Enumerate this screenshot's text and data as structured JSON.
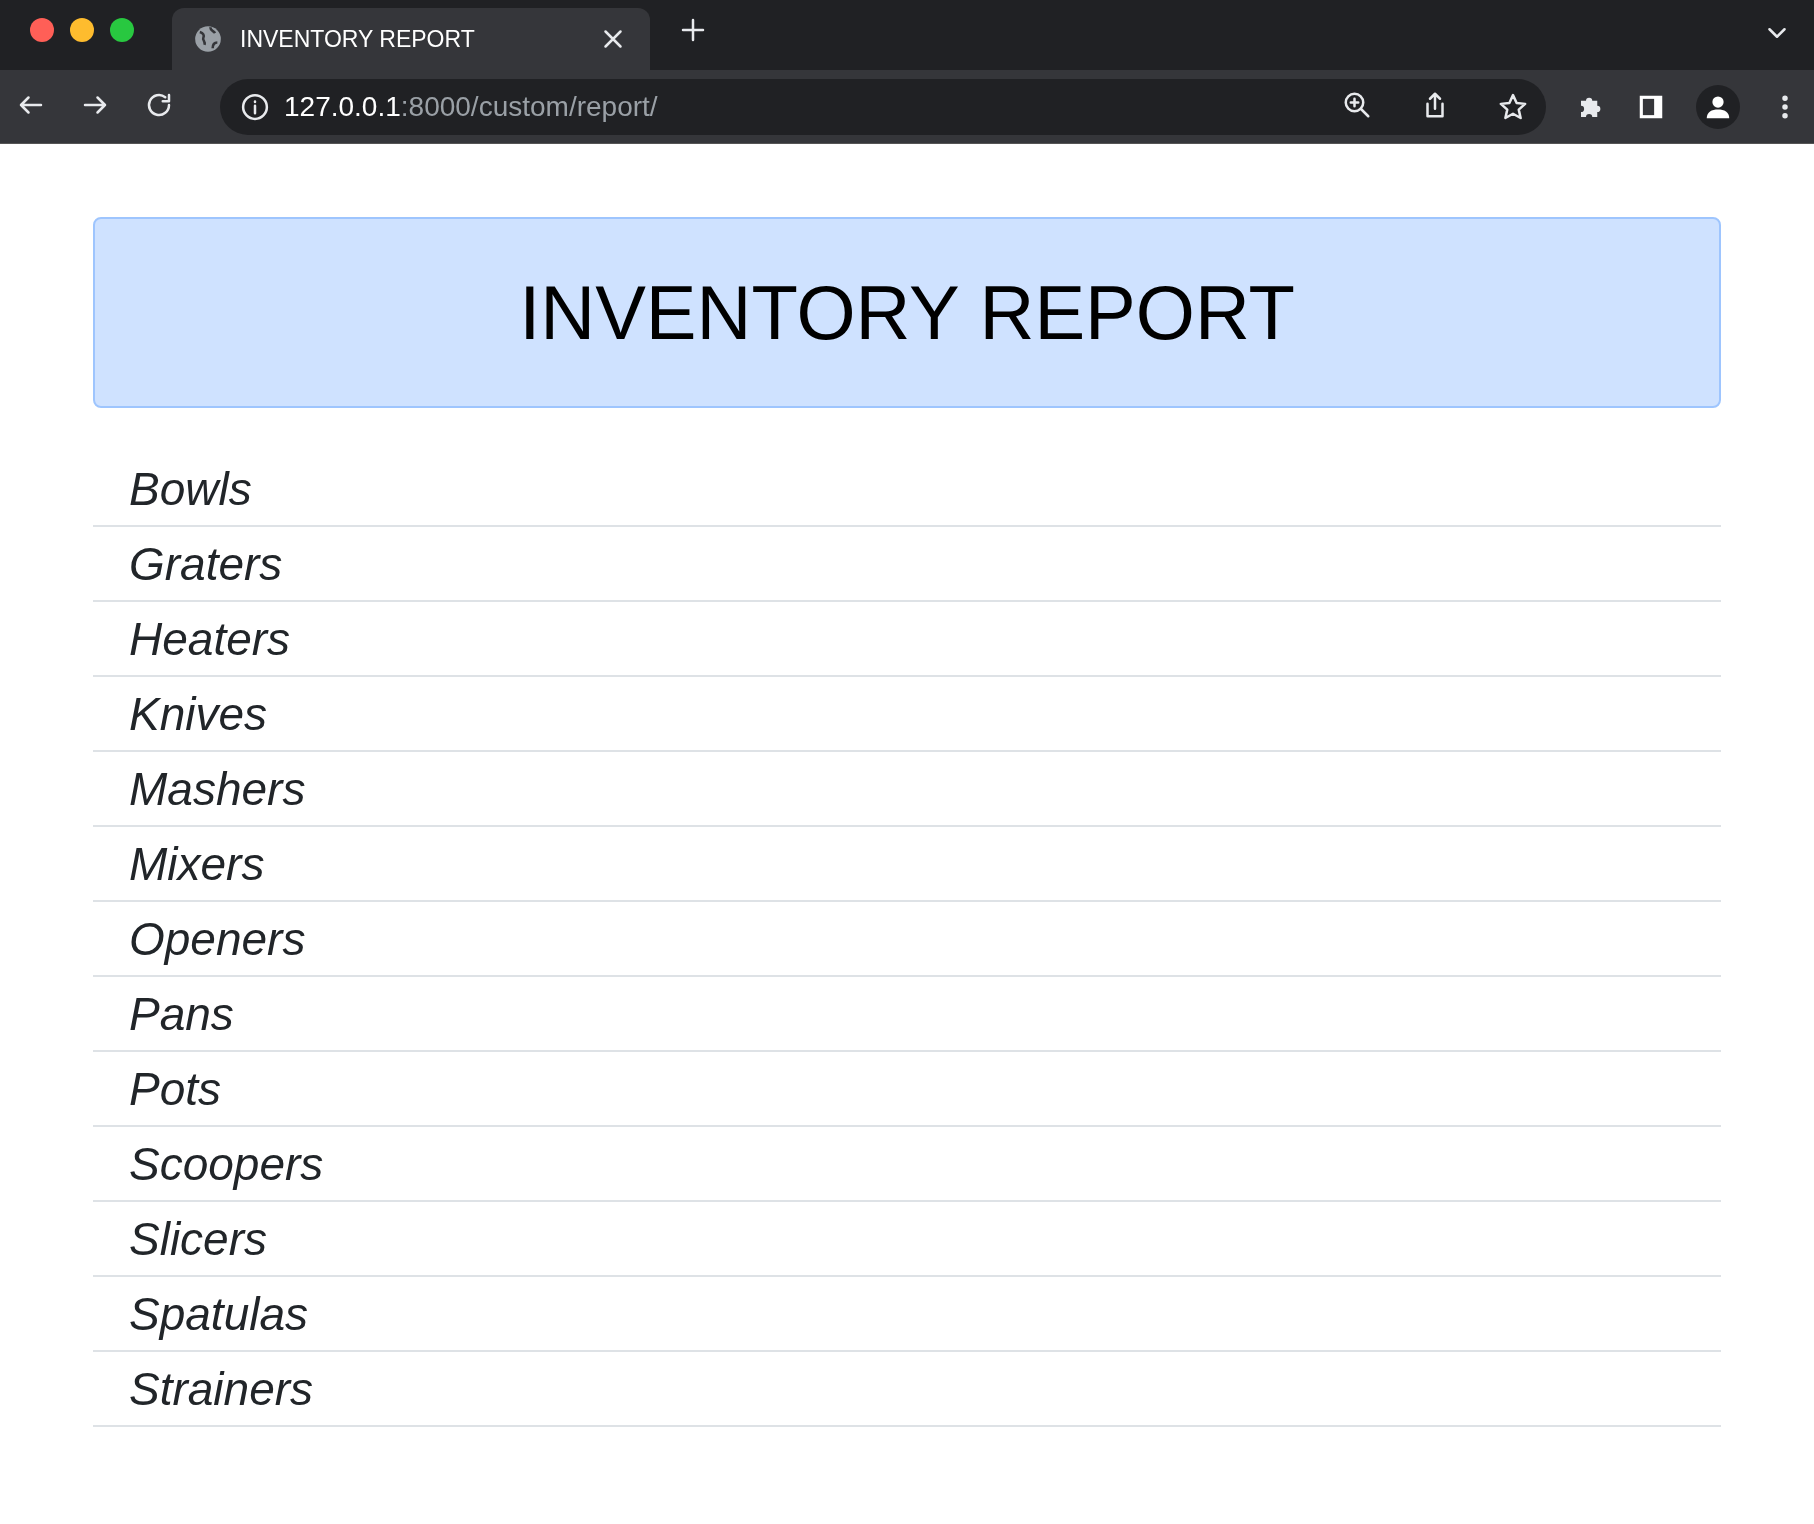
{
  "browser": {
    "tab_title": "INVENTORY REPORT",
    "url_host": "127.0.0.1",
    "url_rest": ":8000/custom/report/"
  },
  "report": {
    "title": "INVENTORY REPORT",
    "items": [
      "Bowls",
      "Graters",
      "Heaters",
      "Knives",
      "Mashers",
      "Mixers",
      "Openers",
      "Pans",
      "Pots",
      "Scoopers",
      "Slicers",
      "Spatulas",
      "Strainers"
    ]
  }
}
